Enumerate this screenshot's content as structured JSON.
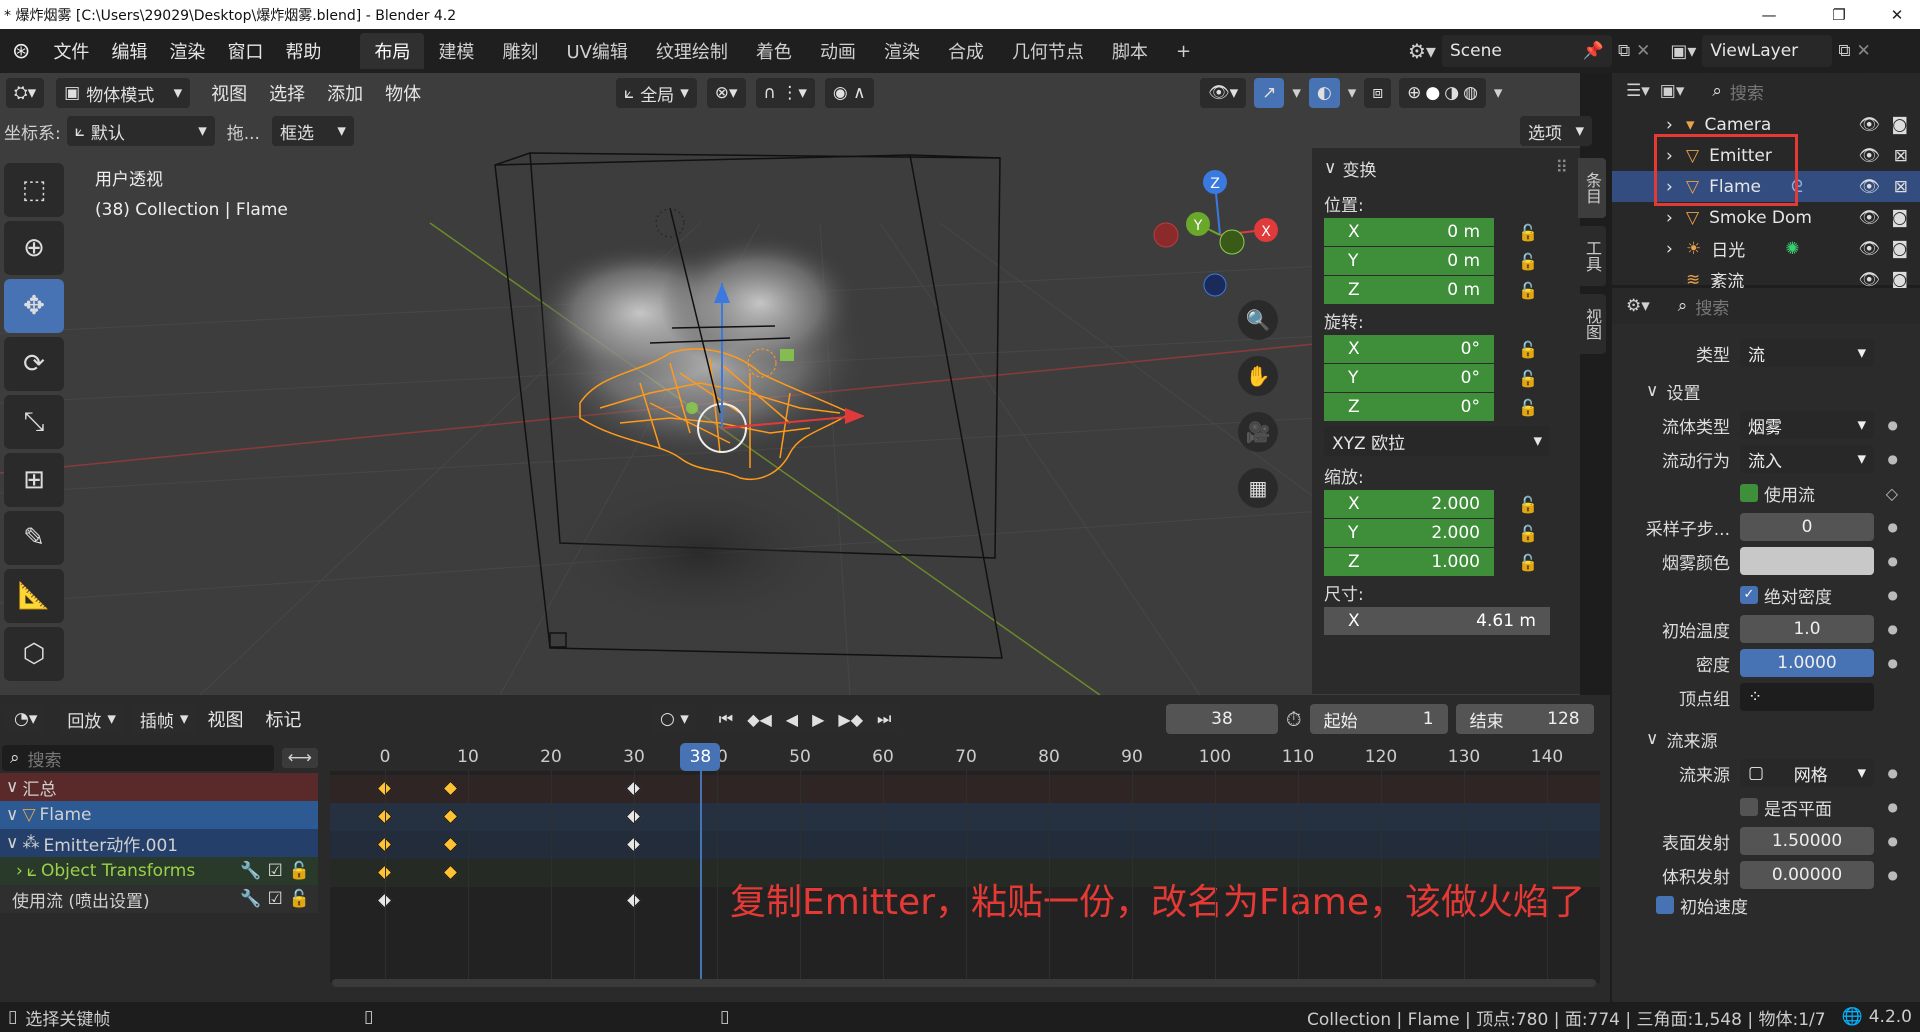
{
  "window": {
    "title": "* 爆炸烟雾 [C:\\Users\\29029\\Desktop\\爆炸烟雾.blend] - Blender 4.2",
    "minimize": "—",
    "maximize": "❐",
    "close": "✕"
  },
  "menu": [
    "文件",
    "编辑",
    "渲染",
    "窗口",
    "帮助"
  ],
  "workspace_tabs": [
    "布局",
    "建模",
    "雕刻",
    "UV编辑",
    "纹理绘制",
    "着色",
    "动画",
    "渲染",
    "合成",
    "几何节点",
    "脚本"
  ],
  "workspace_active": "布局",
  "add_tab": "+",
  "scene": "Scene",
  "view_layer": "ViewLayer",
  "viewport": {
    "mode": "物体模式",
    "menus": [
      "视图",
      "选择",
      "添加",
      "物体"
    ],
    "transform_orient": "全局",
    "coord_label": "坐标系:",
    "coord_value": "默认",
    "drag_label": "拖...",
    "select_mode": "框选",
    "options": "选项",
    "view_name": "用户透视",
    "view_info": "(38) Collection | Flame",
    "gizmo": {
      "x": "X",
      "y": "Y",
      "z": "Z"
    }
  },
  "npanel": {
    "section": "变换",
    "location_label": "位置:",
    "location": [
      {
        "axis": "X",
        "value": "0 m"
      },
      {
        "axis": "Y",
        "value": "0 m"
      },
      {
        "axis": "Z",
        "value": "0 m"
      }
    ],
    "rotation_label": "旋转:",
    "rotation": [
      {
        "axis": "X",
        "value": "0°"
      },
      {
        "axis": "Y",
        "value": "0°"
      },
      {
        "axis": "Z",
        "value": "0°"
      }
    ],
    "rotation_mode": "XYZ 欧拉",
    "scale_label": "缩放:",
    "scale": [
      {
        "axis": "X",
        "value": "2.000"
      },
      {
        "axis": "Y",
        "value": "2.000"
      },
      {
        "axis": "Z",
        "value": "1.000"
      }
    ],
    "dimensions_label": "尺寸:",
    "dimensions": [
      {
        "axis": "X",
        "value": "4.61 m"
      }
    ],
    "tabs": [
      "条目",
      "工具",
      "视图"
    ]
  },
  "outliner": {
    "search_placeholder": "搜索",
    "items": [
      {
        "name": "Camera",
        "selected": false
      },
      {
        "name": "Emitter",
        "selected": false
      },
      {
        "name": "Flame",
        "selected": true
      },
      {
        "name": "Smoke Dom",
        "selected": false
      },
      {
        "name": "日光",
        "selected": false
      },
      {
        "name": "紊流",
        "selected": false
      }
    ]
  },
  "properties": {
    "search_placeholder": "搜索",
    "type_label": "类型",
    "type_value": "流",
    "settings_header": "设置",
    "flow_type_label": "流体类型",
    "flow_type_value": "烟雾",
    "flow_behavior_label": "流动行为",
    "flow_behavior_value": "流入",
    "use_flow_label": "使用流",
    "subframes_label": "采样子步...",
    "subframes_value": "0",
    "smoke_color_label": "烟雾颜色",
    "absolute_density_label": "绝对密度",
    "initial_temp_label": "初始温度",
    "initial_temp_value": "1.0",
    "density_label": "密度",
    "density_value": "1.0000",
    "vertex_group_label": "顶点组",
    "flow_source_header": "流来源",
    "flow_source_label": "流来源",
    "flow_source_value": "网格",
    "is_planar_label": "是否平面",
    "surface_emission_label": "表面发射",
    "surface_emission_value": "1.50000",
    "volume_emission_label": "体积发射",
    "volume_emission_value": "0.00000",
    "initial_velocity_label": "初始速度"
  },
  "timeline": {
    "menus": [
      "回放",
      "插帧",
      "视图",
      "标记"
    ],
    "current_frame": "38",
    "start_label": "起始",
    "start_value": "1",
    "end_label": "结束",
    "end_value": "128",
    "search_placeholder": "搜索",
    "ruler": [
      "0",
      "10",
      "20",
      "30",
      "40",
      "50",
      "60",
      "70",
      "80",
      "90",
      "100",
      "110",
      "120",
      "130",
      "140"
    ],
    "channels": [
      "汇总",
      "Flame",
      "Emitter动作.001",
      "Object Transforms",
      "使用流 (喷出设置)"
    ],
    "annotation": "复制Emitter，粘贴一份，改名为Flame，该做火焰了"
  },
  "statusbar": {
    "left": "选择关键帧",
    "stats": "Collection | Flame | 顶点:780 | 面:774 | 三角面:1,548 | 物体:1/7",
    "version": "4.2.0"
  },
  "colors": {
    "accent": "#4772b3",
    "green_field": "#3f8f3a",
    "selection": "#334d80",
    "highlight_box": "#e53935",
    "wire": "#ff9a1a",
    "annotation": "#e53935"
  }
}
